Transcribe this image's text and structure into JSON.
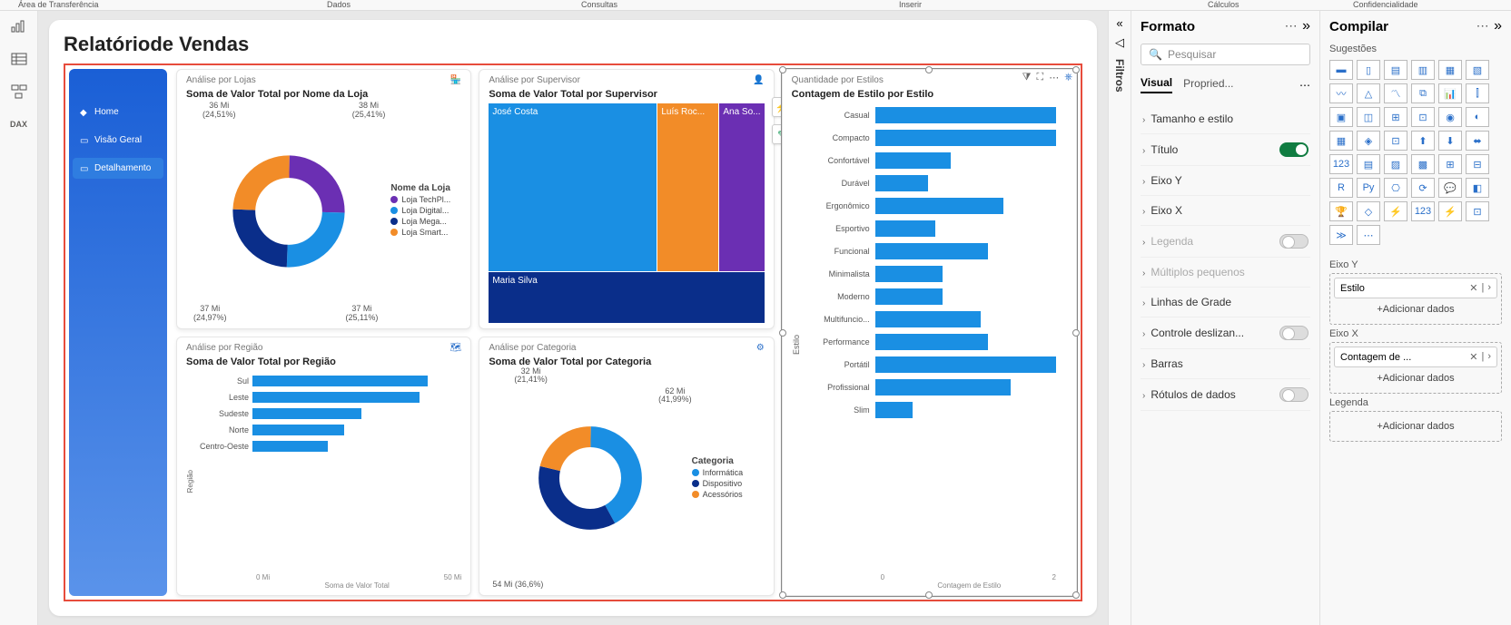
{
  "ribbon_groups": [
    "Área de Transferência",
    "Dados",
    "Consultas",
    "Inserir",
    "Cálculos",
    "Confidencialidade"
  ],
  "report": {
    "title": "Relatóriode Vendas"
  },
  "nav": [
    {
      "label": "Home",
      "active": false,
      "icon": "◆"
    },
    {
      "label": "Visão Geral",
      "active": false,
      "icon": "▭"
    },
    {
      "label": "Detalhamento",
      "active": true,
      "icon": "▭"
    }
  ],
  "cards": {
    "lojas": {
      "header": "Análise por Lojas",
      "title": "Soma de Valor Total por Nome da Loja",
      "legend_title": "Nome da Loja",
      "legend": [
        {
          "label": "Loja TechPl...",
          "color": "#6b2fb3"
        },
        {
          "label": "Loja Digital...",
          "color": "#1a8fe3"
        },
        {
          "label": "Loja Mega...",
          "color": "#0a2e8a"
        },
        {
          "label": "Loja Smart...",
          "color": "#f28c28"
        }
      ],
      "labels": [
        {
          "v": "36 Mi",
          "p": "(24,51%)"
        },
        {
          "v": "38 Mi",
          "p": "(25,41%)"
        },
        {
          "v": "37 Mi",
          "p": "(24,97%)"
        },
        {
          "v": "37 Mi",
          "p": "(25,11%)"
        }
      ]
    },
    "supervisor": {
      "header": "Análise por Supervisor",
      "title": "Soma de Valor Total por Supervisor",
      "cells": [
        {
          "label": "José Costa",
          "color": "#1a8fe3",
          "flex": 3
        },
        {
          "label": "Luís Roc...",
          "color": "#f28c28",
          "flex": 1
        },
        {
          "label": "Ana So...",
          "color": "#6b2fb3",
          "flex": 0.7
        }
      ],
      "bottom": {
        "label": "Maria Silva",
        "color": "#0a2e8a"
      }
    },
    "estilos": {
      "header": "Quantidade por Estilos",
      "title": "Contagem de Estilo por Estilo",
      "ylabel": "Estilo",
      "xlabel": "Contagem de Estilo",
      "ticks": [
        "0",
        "2"
      ],
      "rows": [
        {
          "label": "Casual",
          "v": 2.4
        },
        {
          "label": "Compacto",
          "v": 2.4
        },
        {
          "label": "Confortável",
          "v": 1.0
        },
        {
          "label": "Durável",
          "v": 0.7
        },
        {
          "label": "Ergonômico",
          "v": 1.7
        },
        {
          "label": "Esportivo",
          "v": 0.8
        },
        {
          "label": "Funcional",
          "v": 1.5
        },
        {
          "label": "Minimalista",
          "v": 0.9
        },
        {
          "label": "Moderno",
          "v": 0.9
        },
        {
          "label": "Multifuncio...",
          "v": 1.4
        },
        {
          "label": "Performance",
          "v": 1.5
        },
        {
          "label": "Portátil",
          "v": 2.4
        },
        {
          "label": "Profissional",
          "v": 1.8
        },
        {
          "label": "Slim",
          "v": 0.5
        }
      ]
    },
    "regiao": {
      "header": "Análise por Região",
      "title": "Soma de Valor Total por Região",
      "ylabel": "Região",
      "xlabel": "Soma de Valor Total",
      "ticks": [
        "0 Mi",
        "50 Mi"
      ],
      "rows": [
        {
          "label": "Sul",
          "v": 42
        },
        {
          "label": "Leste",
          "v": 40
        },
        {
          "label": "Sudeste",
          "v": 26
        },
        {
          "label": "Norte",
          "v": 22
        },
        {
          "label": "Centro-Oeste",
          "v": 18
        }
      ],
      "max": 50
    },
    "categoria": {
      "header": "Análise por Categoria",
      "title": "Soma de Valor Total por Categoria",
      "legend_title": "Categoria",
      "legend": [
        {
          "label": "Informática",
          "color": "#1a8fe3"
        },
        {
          "label": "Dispositivo",
          "color": "#0a2e8a"
        },
        {
          "label": "Acessórios",
          "color": "#f28c28"
        }
      ],
      "labels": [
        {
          "v": "32 Mi",
          "p": "(21,41%)"
        },
        {
          "v": "62 Mi",
          "p": "(41,99%)"
        },
        {
          "v": "54 Mi",
          "p": "(36,6%)"
        }
      ]
    }
  },
  "filters_label": "Filtros",
  "format": {
    "title": "Formato",
    "search_placeholder": "Pesquisar",
    "tabs": [
      "Visual",
      "Propried..."
    ],
    "rows": [
      {
        "label": "Tamanho e estilo",
        "toggle": null,
        "disabled": false
      },
      {
        "label": "Título",
        "toggle": "on",
        "disabled": false
      },
      {
        "label": "Eixo Y",
        "toggle": null,
        "disabled": false
      },
      {
        "label": "Eixo X",
        "toggle": null,
        "disabled": false
      },
      {
        "label": "Legenda",
        "toggle": "off",
        "disabled": true
      },
      {
        "label": "Múltiplos pequenos",
        "toggle": null,
        "disabled": true
      },
      {
        "label": "Linhas de Grade",
        "toggle": null,
        "disabled": false
      },
      {
        "label": "Controle deslizan...",
        "toggle": "off",
        "disabled": false
      },
      {
        "label": "Barras",
        "toggle": null,
        "disabled": false
      },
      {
        "label": "Rótulos de dados",
        "toggle": "off",
        "disabled": false
      }
    ]
  },
  "compile": {
    "title": "Compilar",
    "suggestions": "Sugestões",
    "sections": [
      {
        "title": "Eixo Y",
        "pill": "Estilo",
        "add": "+Adicionar dados"
      },
      {
        "title": "Eixo X",
        "pill": "Contagem de ...",
        "add": "+Adicionar dados"
      },
      {
        "title": "Legenda",
        "pill": null,
        "add": "+Adicionar dados"
      }
    ]
  },
  "chart_data": [
    {
      "type": "pie",
      "title": "Soma de Valor Total por Nome da Loja",
      "series": [
        {
          "name": "Loja TechPl...",
          "value": 38,
          "pct": 25.41
        },
        {
          "name": "Loja Digital...",
          "value": 37,
          "pct": 25.11
        },
        {
          "name": "Loja Mega...",
          "value": 37,
          "pct": 24.97
        },
        {
          "name": "Loja Smart...",
          "value": 36,
          "pct": 24.51
        }
      ],
      "unit": "Mi"
    },
    {
      "type": "treemap",
      "title": "Soma de Valor Total por Supervisor",
      "series": [
        {
          "name": "José Costa"
        },
        {
          "name": "Luís Roc..."
        },
        {
          "name": "Ana So..."
        },
        {
          "name": "Maria Silva"
        }
      ]
    },
    {
      "type": "bar",
      "title": "Contagem de Estilo por Estilo",
      "xlabel": "Contagem de Estilo",
      "ylabel": "Estilo",
      "categories": [
        "Casual",
        "Compacto",
        "Confortável",
        "Durável",
        "Ergonômico",
        "Esportivo",
        "Funcional",
        "Minimalista",
        "Moderno",
        "Multifuncio...",
        "Performance",
        "Portátil",
        "Profissional",
        "Slim"
      ],
      "values": [
        2.4,
        2.4,
        1.0,
        0.7,
        1.7,
        0.8,
        1.5,
        0.9,
        0.9,
        1.4,
        1.5,
        2.4,
        1.8,
        0.5
      ],
      "xlim": [
        0,
        2.5
      ]
    },
    {
      "type": "bar",
      "title": "Soma de Valor Total por Região",
      "xlabel": "Soma de Valor Total",
      "ylabel": "Região",
      "categories": [
        "Sul",
        "Leste",
        "Sudeste",
        "Norte",
        "Centro-Oeste"
      ],
      "values": [
        42,
        40,
        26,
        22,
        18
      ],
      "xlim": [
        0,
        50
      ],
      "unit": "Mi"
    },
    {
      "type": "pie",
      "title": "Soma de Valor Total por Categoria",
      "series": [
        {
          "name": "Informática",
          "value": 62,
          "pct": 41.99
        },
        {
          "name": "Dispositivo",
          "value": 54,
          "pct": 36.6
        },
        {
          "name": "Acessórios",
          "value": 32,
          "pct": 21.41
        }
      ],
      "unit": "Mi"
    }
  ]
}
